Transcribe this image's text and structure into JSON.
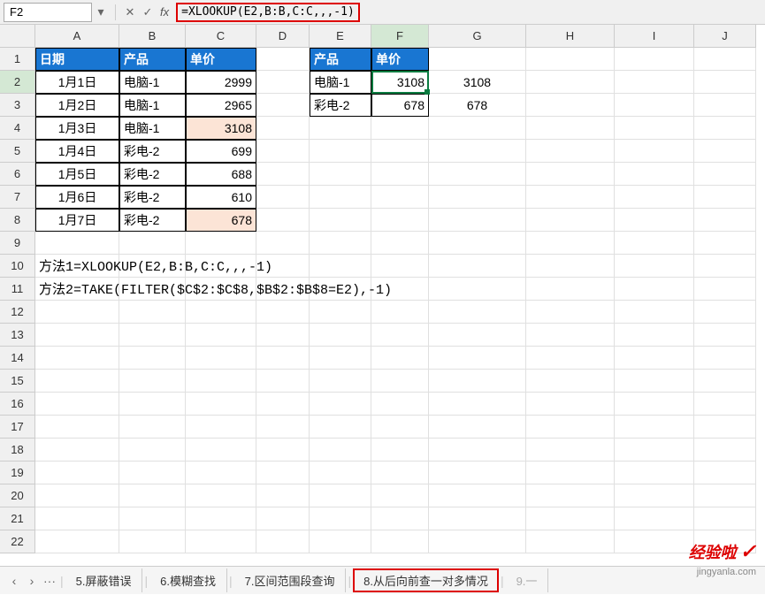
{
  "formula_bar": {
    "cell_ref": "F2",
    "formula": "=XLOOKUP(E2,B:B,C:C,,,-1)"
  },
  "columns": [
    "A",
    "B",
    "C",
    "D",
    "E",
    "F",
    "G",
    "H",
    "I",
    "J"
  ],
  "rows": [
    "1",
    "2",
    "3",
    "4",
    "5",
    "6",
    "7",
    "8",
    "9",
    "10",
    "11",
    "12",
    "13",
    "14",
    "15",
    "16",
    "17",
    "18",
    "19",
    "20",
    "21",
    "22"
  ],
  "active_col": "F",
  "active_row": "2",
  "main_table": {
    "headers": {
      "date": "日期",
      "product": "产品",
      "price": "单价"
    },
    "rows": [
      {
        "date": "1月1日",
        "product": "电脑-1",
        "price": "2999"
      },
      {
        "date": "1月2日",
        "product": "电脑-1",
        "price": "2965"
      },
      {
        "date": "1月3日",
        "product": "电脑-1",
        "price": "3108",
        "hl": true
      },
      {
        "date": "1月4日",
        "product": "彩电-2",
        "price": "699"
      },
      {
        "date": "1月5日",
        "product": "彩电-2",
        "price": "688"
      },
      {
        "date": "1月6日",
        "product": "彩电-2",
        "price": "610"
      },
      {
        "date": "1月7日",
        "product": "彩电-2",
        "price": "678",
        "hl": true
      }
    ]
  },
  "lookup_table": {
    "headers": {
      "product": "产品",
      "price": "单价"
    },
    "rows": [
      {
        "product": "电脑-1",
        "price": "3108"
      },
      {
        "product": "彩电-2",
        "price": "678"
      }
    ]
  },
  "col_g": [
    "3108",
    "678"
  ],
  "notes": {
    "line1": "方法1=XLOOKUP(E2,B:B,C:C,,,-1)",
    "line2": "方法2=TAKE(FILTER($C$2:$C$8,$B$2:$B$8=E2),-1)"
  },
  "sheet_tabs": {
    "nav_prev": "‹",
    "nav_next": "›",
    "nav_more": "···",
    "tabs": [
      "5.屏蔽错误",
      "6.模糊查找",
      "7.区间范围段查询",
      "8.从后向前查一对多情况",
      "9.一"
    ],
    "active_index": 3
  },
  "watermark": {
    "text": "经验啦",
    "check": "✓",
    "url": "jingyanla.com"
  }
}
